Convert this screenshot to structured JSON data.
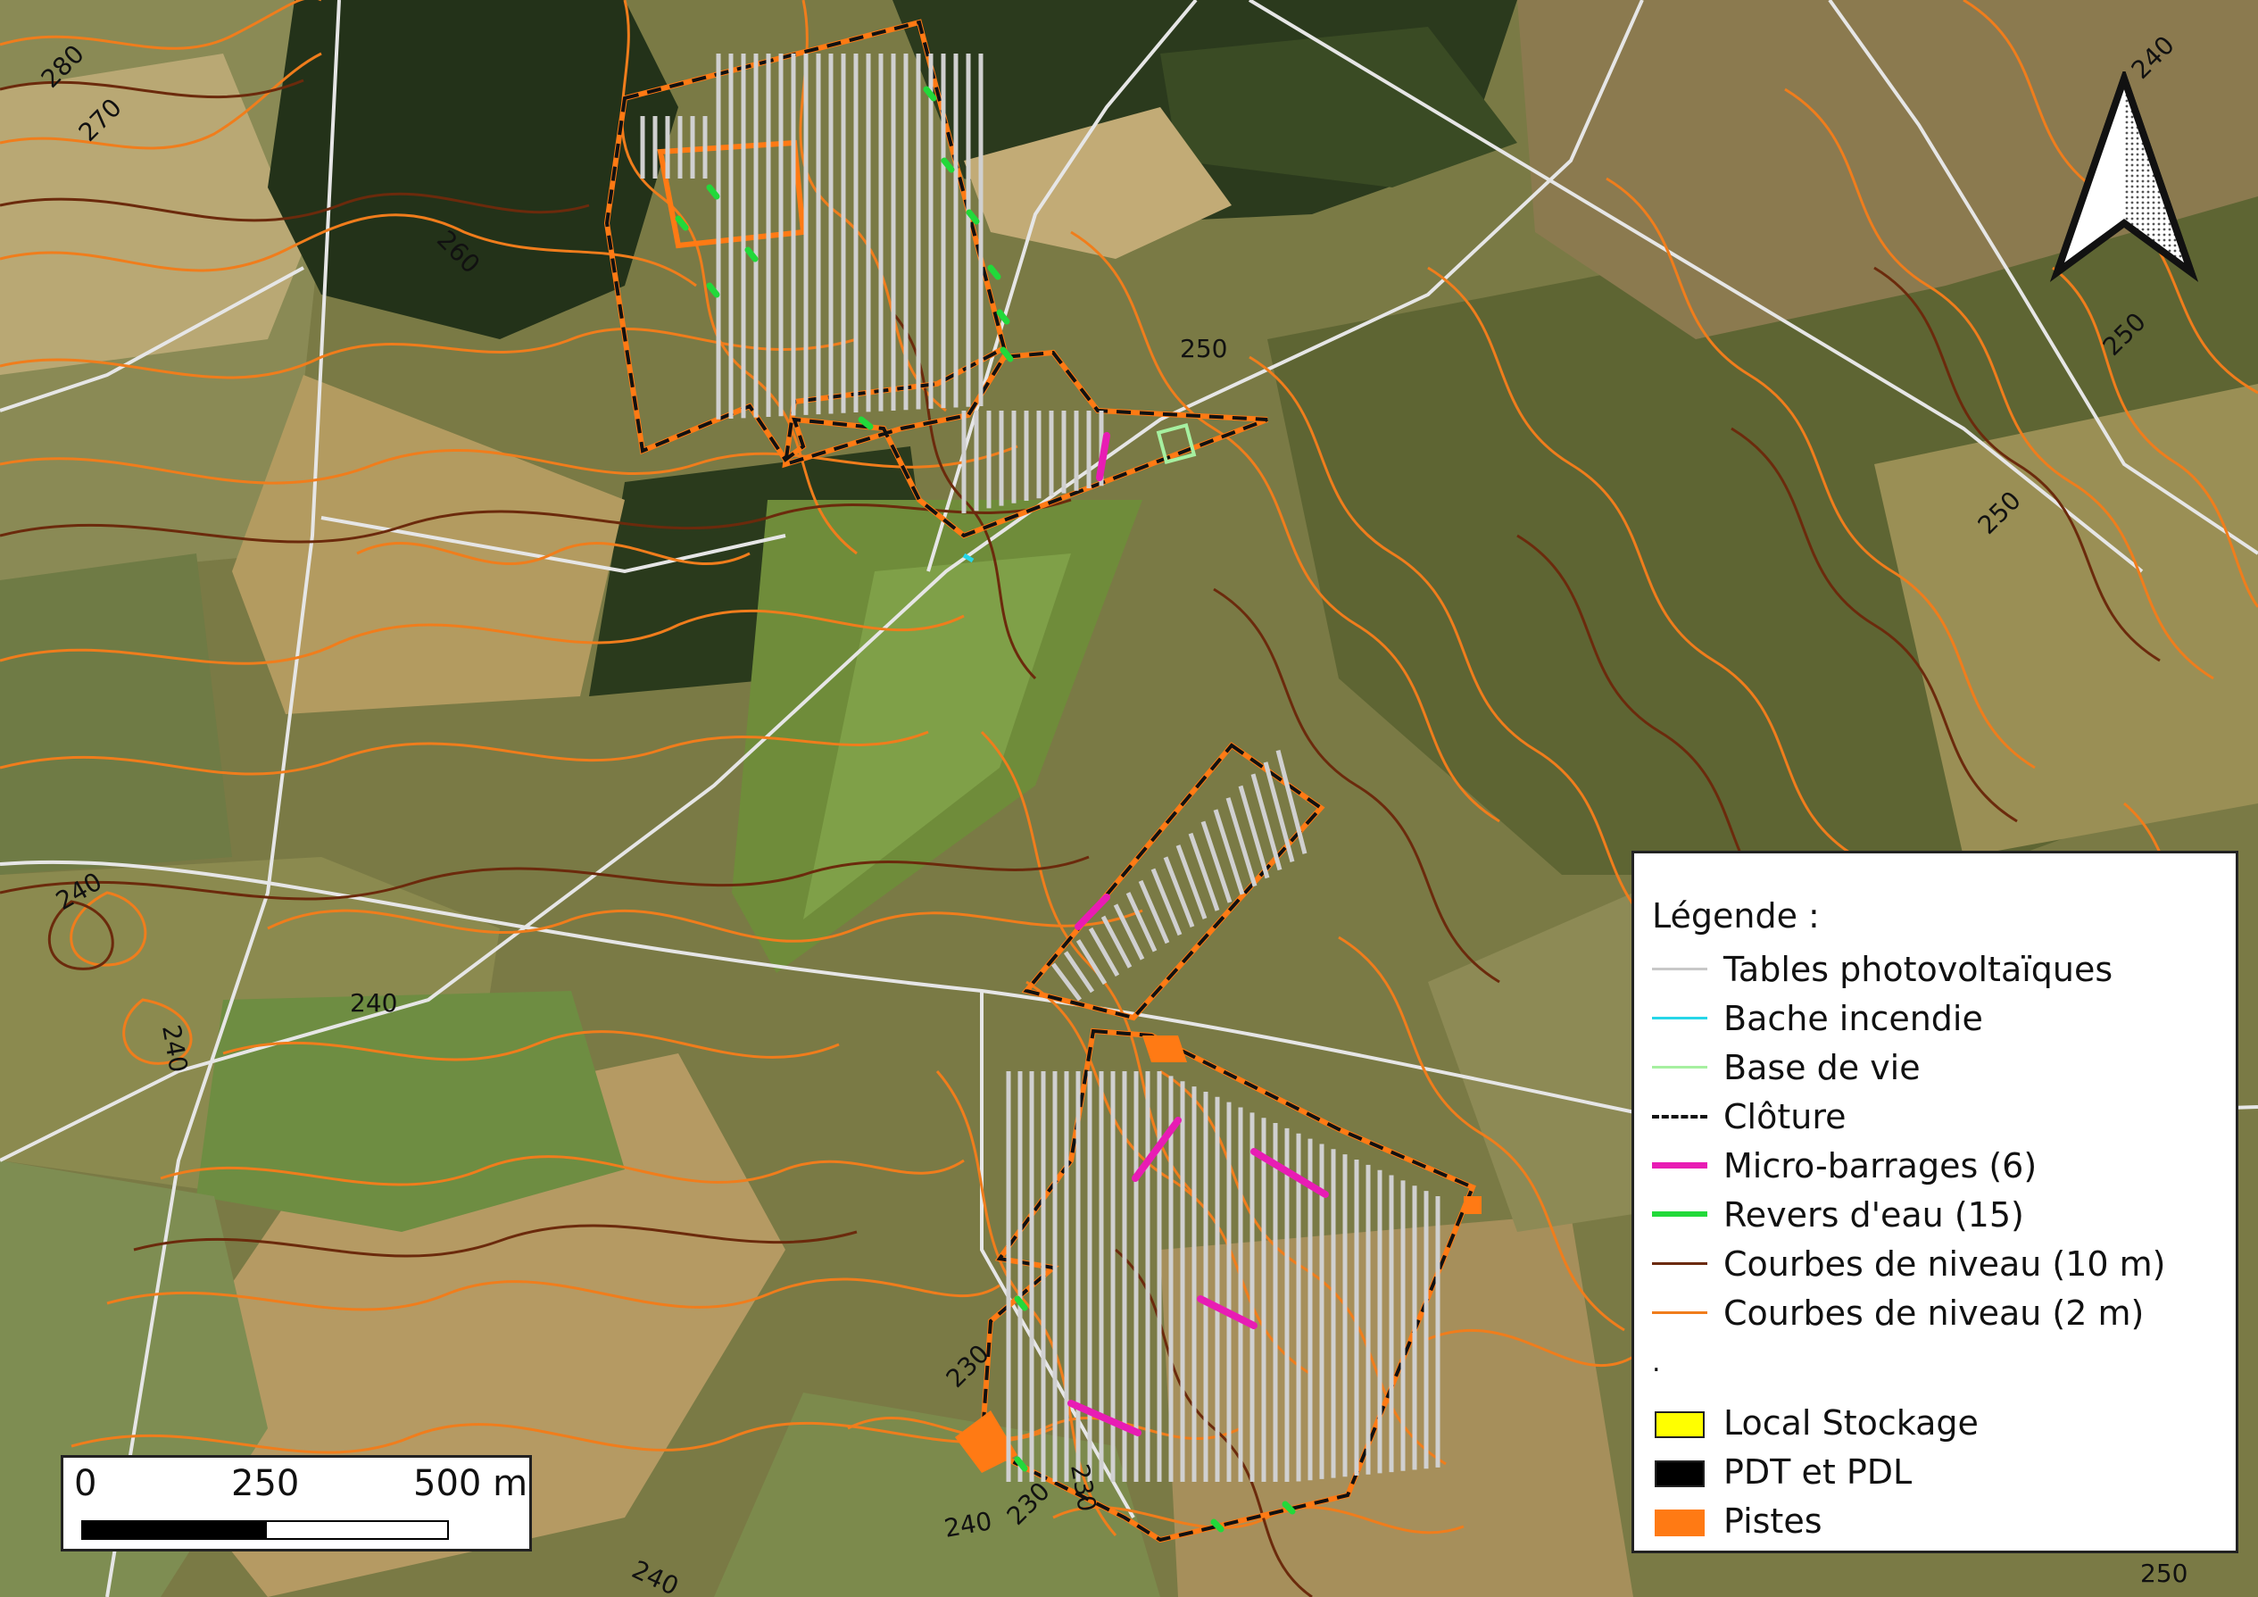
{
  "map": {
    "contour_labels": [
      "280",
      "270",
      "260",
      "250",
      "240",
      "240",
      "240",
      "240",
      "230",
      "230",
      "230",
      "240",
      "250",
      "250",
      "250",
      "240"
    ]
  },
  "legend": {
    "title": "Légende :",
    "items": [
      {
        "label": "Tables photovoltaïques",
        "symbol": "line",
        "color": "#c8c8c8"
      },
      {
        "label": "Bache incendie",
        "symbol": "line",
        "color": "#26d6e8"
      },
      {
        "label": "Base de vie",
        "symbol": "line",
        "color": "#a6f0a0"
      },
      {
        "label": "Clôture",
        "symbol": "dashed-line",
        "color": "#111111"
      },
      {
        "label": "Micro-barrages (6)",
        "symbol": "thick-line",
        "color": "#e81cb4"
      },
      {
        "label": "Revers d'eau (15)",
        "symbol": "thick-line",
        "color": "#22d93a"
      },
      {
        "label": "Courbes de niveau (10 m)",
        "symbol": "line",
        "color": "#6b2a0c"
      },
      {
        "label": "Courbes de niveau (2 m)",
        "symbol": "line",
        "color": "#f07d1c"
      },
      {
        "label": "Local Stockage",
        "symbol": "box",
        "color": "#ffff00"
      },
      {
        "label": "PDT et PDL",
        "symbol": "box",
        "color": "#000000"
      },
      {
        "label": "Pistes",
        "symbol": "box",
        "color": "#ff7a14"
      }
    ],
    "separator": "."
  },
  "scalebar": {
    "labels": [
      "0",
      "250",
      "500 m"
    ]
  },
  "north_arrow": {
    "icon": "north-arrow-icon"
  },
  "colors": {
    "contour_2m": "#f07d1c",
    "contour_10m": "#6b2a0c",
    "fence": "#111111",
    "pistes": "#ff7a14",
    "pv_tables": "#d0d0d0",
    "micro_barrages": "#e81cb4",
    "revers_eau": "#22d93a",
    "road": "#e6e6e6",
    "forest": "#2f3f1e",
    "field_light": "#b59a63",
    "field_green": "#6c8a3d"
  }
}
